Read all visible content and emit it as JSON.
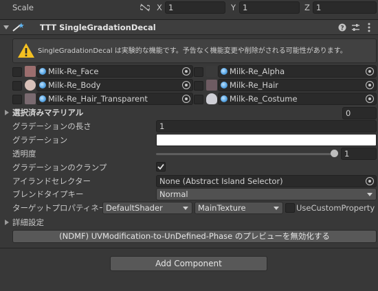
{
  "transform": {
    "scale_label": "Scale",
    "x_label": "X",
    "x_value": "1",
    "y_label": "Y",
    "y_value": "1",
    "z_label": "Z",
    "z_value": "1"
  },
  "component": {
    "title": "TTT SingleGradationDecal",
    "warning": "SingleGradationDecal は実験的な機能です。予告なく機能変更や削除がされる可能性があります。"
  },
  "materials": [
    {
      "label": "Milk-Re_Face",
      "thumb": "#9c6e6e"
    },
    {
      "label": "Milk-Re_Alpha",
      "thumb": "#3a3a3a"
    },
    {
      "label": "Milk-Re_Body",
      "thumb": "#d8c0b8"
    },
    {
      "label": "Milk-Re_Hair",
      "thumb": "#6e5b62"
    },
    {
      "label": "Milk-Re_Hair_Transparent",
      "thumb": "#7a6a70"
    },
    {
      "label": "Milk-Re_Costume",
      "thumb": "#cfcfd6"
    }
  ],
  "selected_materials": {
    "label": "選択済みマテリアル",
    "count": "0"
  },
  "props": {
    "gradation_length_label": "グラデーションの長さ",
    "gradation_length_value": "1",
    "gradation_label": "グラデーション",
    "alpha_label": "透明度",
    "alpha_value": "1",
    "clamp_label": "グラデーションのクランプ",
    "island_label": "アイランドセレクター",
    "island_value": "None (Abstract Island Selector)",
    "blend_label": "ブレンドタイプキー",
    "blend_value": "Normal",
    "target_label": "ターゲットプロパティネーム",
    "shader_value": "DefaultShader",
    "texture_value": "MainTexture",
    "custom_prop_label": "UseCustomProperty"
  },
  "details_label": "詳細設定",
  "preview_button": "(NDMF) UVModification-to-UnDefined-Phase のプレビューを無効化する",
  "add_component": "Add Component",
  "colors": {
    "accent": "#4a9ee8",
    "warning": "#f4c021",
    "panel": "#383838"
  }
}
